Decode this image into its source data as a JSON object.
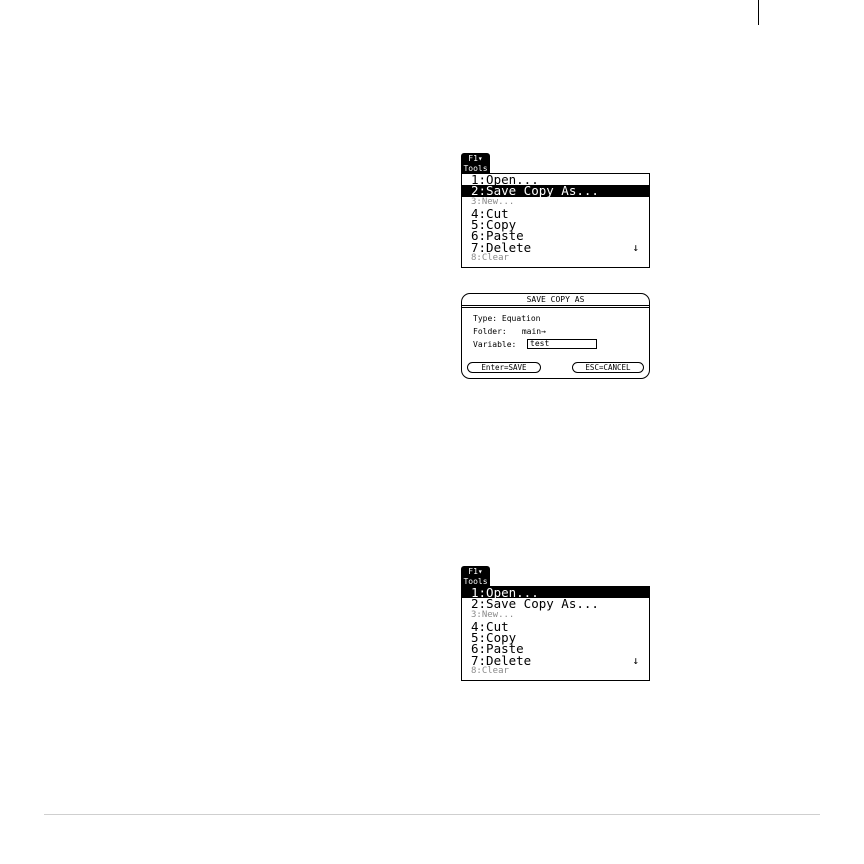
{
  "tools_tab": {
    "fkey": "F1▾",
    "label": "Tools"
  },
  "menu_top": {
    "items": [
      {
        "label": "1:Open..."
      },
      {
        "label": "2:Save Copy As..."
      },
      {
        "label": "3:New..."
      },
      {
        "label": "4:Cut"
      },
      {
        "label": "5:Copy"
      },
      {
        "label": "6:Paste"
      },
      {
        "label": "7:Delete"
      },
      {
        "label": "8:Clear"
      }
    ],
    "more_indicator": "↓"
  },
  "dialog": {
    "title": "SAVE COPY AS",
    "type_label": "Type:",
    "type_value": "Equation",
    "folder_label": "Folder:",
    "folder_value": "main→",
    "variable_label": "Variable:",
    "variable_value": "test",
    "save_button": "Enter=SAVE",
    "cancel_button": "ESC=CANCEL"
  },
  "menu_bottom": {
    "items": [
      {
        "label": "1:Open..."
      },
      {
        "label": "2:Save Copy As..."
      },
      {
        "label": "3:New..."
      },
      {
        "label": "4:Cut"
      },
      {
        "label": "5:Copy"
      },
      {
        "label": "6:Paste"
      },
      {
        "label": "7:Delete"
      },
      {
        "label": "8:Clear"
      }
    ],
    "more_indicator": "↓"
  }
}
